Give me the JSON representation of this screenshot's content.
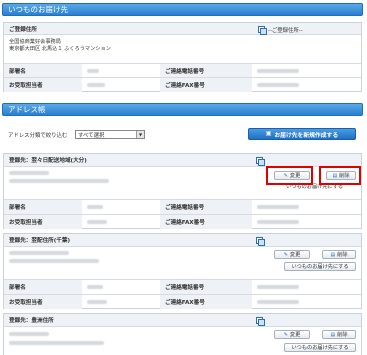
{
  "usual_destination": {
    "title": "いつものお届け先",
    "registered_address_label": "ご登録住所",
    "default_address_option": "--ご登録住所--",
    "address_lines": [
      "全国協商業好会事務局",
      "東京都大田区 北馬込１ ふくろうマンション"
    ],
    "dept_label": "部署名",
    "phone_label": "ご連絡電話番号",
    "contact_label": "お受取担当者",
    "fax_label": "ご連絡FAX番号"
  },
  "address_book": {
    "title": "アドレス帳",
    "filter_label": "アドレス分類で絞り込む",
    "filter_value": "すべて選択",
    "new_button": "お届け先を新規作成する",
    "entries": [
      {
        "heading": "登録先：翌々日配送地域(大分)",
        "edit": "変更",
        "delete": "削除",
        "set_usual": "いつものお届け先にする"
      },
      {
        "heading": "登録先：翌配住所(千葉)",
        "edit": "変更",
        "delete": "削除",
        "set_usual": "いつものお届け先にする"
      },
      {
        "heading": "登録先：豊洲住所",
        "edit": "変更",
        "delete": "削除",
        "set_usual": "いつものお届け先にする"
      }
    ],
    "dept_label": "部署名",
    "phone_label": "ご連絡電話番号",
    "contact_label": "お受取担当者",
    "fax_label": "ご連絡FAX番号"
  },
  "colors": {
    "header_blue": "#2a7fd0",
    "highlight_red": "#e00000"
  },
  "icons": {
    "copy": "copy-icon",
    "edit": "pencil-icon",
    "delete": "trash-icon",
    "new": "add-icon"
  }
}
